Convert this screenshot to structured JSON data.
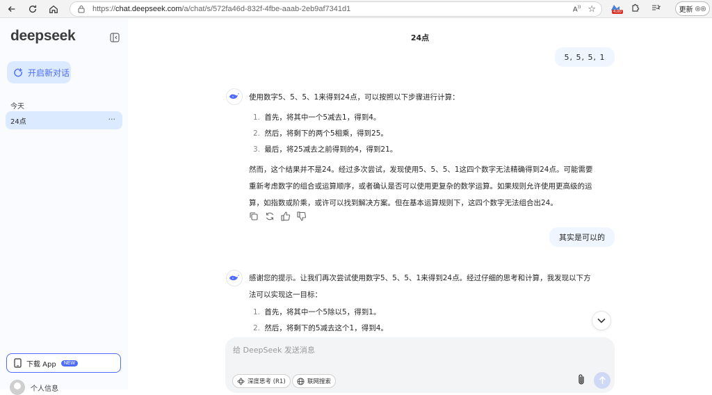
{
  "browser": {
    "url_prefix": "https://",
    "url_host": "chat.deepseek.com",
    "url_path": "/a/chat/s/572fa46d-832f-4fbe-aaab-2eb9af7341d1",
    "ext_badge": "4.00",
    "update_label": "更新"
  },
  "sidebar": {
    "logo": "deepseek",
    "new_chat_label": "开启新对话",
    "section_today": "今天",
    "chat_items": [
      {
        "label": "24点",
        "more": "···"
      }
    ],
    "download_label": "下载 App",
    "download_badge": "NEW",
    "profile_label": "个人信息"
  },
  "main": {
    "title": "24点",
    "messages": {
      "user1": "5, 5, 5, 1",
      "ai1_intro": "使用数字5、5、5、1来得到24点，可以按照以下步骤进行计算：",
      "ai1_steps": [
        {
          "num": "1.",
          "text": "首先，将其中一个5减去1，得到4。"
        },
        {
          "num": "2.",
          "text": "然后，将剩下的两个5相乘，得到25。"
        },
        {
          "num": "3.",
          "text": "最后，将25减去之前得到的4，得到21。"
        }
      ],
      "ai1_para_1": "然而，这个结果并不是24。经过多次尝试，发现使用5、5、5、1这四个数字无法精确得到24点。可能需要",
      "ai1_para_2": "重新考虑数字的组合或运算顺序，或者确认是否可以使用更复杂的数学运算。如果规则允许使用更高级的运",
      "ai1_para_3": "算，如指数或阶乘，或许可以找到解决方案。但在基本运算规则下，这四个数字无法组合出24。",
      "user2": "其实是可以的",
      "ai2_line1": "感谢您的提示。让我们再次尝试使用数字5、5、5、1来得到24点。经过仔细的思考和计算，我发现以下方",
      "ai2_line2": "法可以实现这一目标：",
      "ai2_steps": [
        {
          "num": "1.",
          "text": "首先，将其中一个5除以5，得到1。"
        },
        {
          "num": "2.",
          "text": "然后，将剩下的5减去这个1，得到4。"
        }
      ]
    },
    "input": {
      "placeholder": "给 DeepSeek 发送消息",
      "deep_think_label": "深度思考 (R1)",
      "web_search_label": "联网搜索"
    }
  },
  "colors": {
    "accent": "#4d6bfe",
    "sidebar_bg": "#f9fbff",
    "selected_bg": "#dbeafe",
    "user_bubble": "#eff6ff"
  }
}
